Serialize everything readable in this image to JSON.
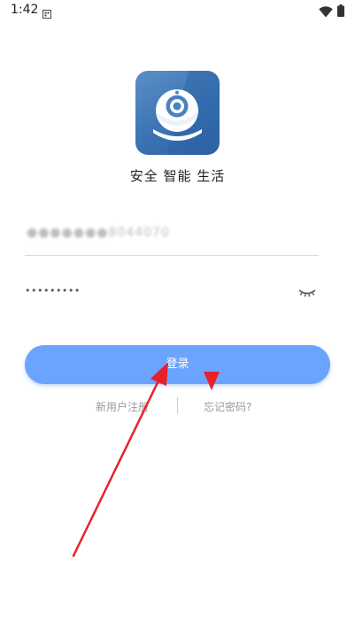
{
  "status_bar": {
    "time": "1:42"
  },
  "app": {
    "slogan": "安全 智能 生活",
    "logo_icon": "security-camera-icon"
  },
  "login_form": {
    "phone_value": "●●●●●●●8044070",
    "password_value": "•••••••••",
    "password_toggle_icon": "eye-closed-icon",
    "login_label": "登录",
    "register_label": "新用户注册",
    "forgot_label": "忘记密码?"
  },
  "colors": {
    "accent": "#6aa4ff",
    "logo_blue": "#3b73b4",
    "annotation_arrow": "#e8202a"
  }
}
